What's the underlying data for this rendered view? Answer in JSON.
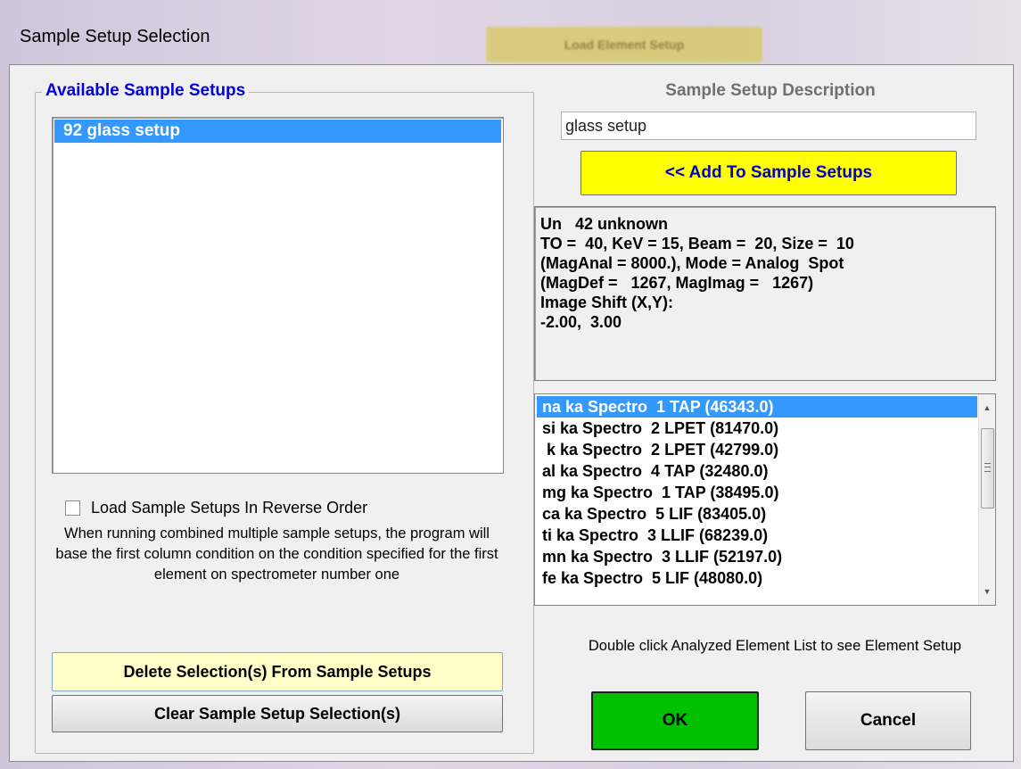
{
  "window": {
    "title": "Sample Setup Selection",
    "background_button": "Load Element Setup"
  },
  "left_panel": {
    "group_title": "Available Sample Setups",
    "setups": [
      "92 glass setup"
    ],
    "selected_index": 0,
    "reverse_order_checkbox": {
      "label": "Load Sample Setups In Reverse Order",
      "checked": false
    },
    "help_text": "When running combined multiple sample setups, the program will base the first column condition on the condition specified for the first element on spectrometer number one",
    "delete_button": "Delete Selection(s) From Sample Setups",
    "clear_button": "Clear Sample Setup Selection(s)"
  },
  "right_panel": {
    "description_heading": "Sample Setup Description",
    "description_value": "glass setup",
    "add_button": "<< Add To Sample Setups",
    "info_lines": [
      "Un   42 unknown",
      "TO =  40, KeV = 15, Beam =  20, Size =  10",
      "(MagAnal = 8000.), Mode = Analog  Spot",
      "(MagDef =   1267, MagImag =   1267)",
      "Image Shift (X,Y):",
      "-2.00,  3.00"
    ],
    "elements": [
      "na ka Spectro  1 TAP (46343.0)",
      "si ka Spectro  2 LPET (81470.0)",
      " k ka Spectro  2 LPET (42799.0)",
      "al ka Spectro  4 TAP (32480.0)",
      "mg ka Spectro  1 TAP (38495.0)",
      "ca ka Spectro  5 LIF (83405.0)",
      "ti ka Spectro  3 LLIF (68239.0)",
      "mn ka Spectro  3 LLIF (52197.0)",
      "fe ka Spectro  5 LIF (48080.0)"
    ],
    "selected_element_index": 0,
    "hint_text": "Double click Analyzed Element List to see Element Setup",
    "ok_button": "OK",
    "cancel_button": "Cancel"
  },
  "colors": {
    "selection": "#3399ff",
    "group_title": "#0000e0",
    "add_button_bg": "#ffff00",
    "add_button_text": "#0000c8",
    "ok_button_bg": "#00c000",
    "delete_button_bg": "#ffffc8"
  }
}
